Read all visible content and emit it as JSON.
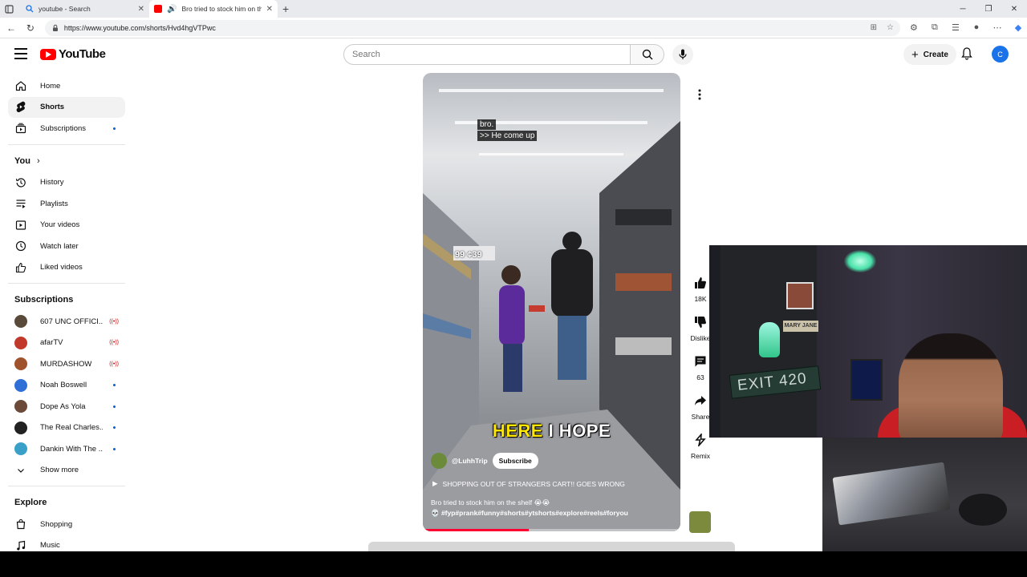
{
  "browser": {
    "tabs": [
      {
        "title": "youtube - Search",
        "active": false
      },
      {
        "title": "Bro tried to stock him on the",
        "active": true
      }
    ],
    "url": "https://www.youtube.com/shorts/Hvd4hgVTPwc"
  },
  "header": {
    "logo": "YouTube",
    "search_placeholder": "Search",
    "create_label": "Create",
    "avatar_letter": "C"
  },
  "sidebar": {
    "main": [
      {
        "label": "Home",
        "icon": "home-icon"
      },
      {
        "label": "Shorts",
        "icon": "shorts-icon",
        "active": true
      },
      {
        "label": "Subscriptions",
        "icon": "subscriptions-icon",
        "dot": true
      }
    ],
    "you_heading": "You",
    "you": [
      {
        "label": "History",
        "icon": "history-icon"
      },
      {
        "label": "Playlists",
        "icon": "playlists-icon"
      },
      {
        "label": "Your videos",
        "icon": "your-videos-icon"
      },
      {
        "label": "Watch later",
        "icon": "watch-later-icon"
      },
      {
        "label": "Liked videos",
        "icon": "liked-videos-icon"
      }
    ],
    "subs_heading": "Subscriptions",
    "subs": [
      {
        "label": "607 UNC OFFICI...",
        "color": "#5a4a3a",
        "live": true
      },
      {
        "label": "afarTV",
        "color": "#c0392b",
        "live": true
      },
      {
        "label": "MURDASHOW",
        "color": "#a0522d",
        "live": true
      },
      {
        "label": "Noah Boswell",
        "color": "#2f6fd6",
        "dot": true
      },
      {
        "label": "Dope As Yola",
        "color": "#6b4a3a",
        "dot": true
      },
      {
        "label": "The Real Charles...",
        "color": "#222222",
        "dot": true
      },
      {
        "label": "Dankin With The ...",
        "color": "#3aa0c8",
        "dot": true
      }
    ],
    "show_more": "Show more",
    "explore_heading": "Explore",
    "explore": [
      {
        "label": "Shopping",
        "icon": "shopping-icon"
      },
      {
        "label": "Music",
        "icon": "music-icon"
      }
    ]
  },
  "short": {
    "caption_line1": "bro.",
    "caption_line2": ">> He come up",
    "price_text": "99 ¢39",
    "overlay_word1": "HERE",
    "overlay_word2": "I HOPE",
    "channel": "@LuhhTrip",
    "subscribe": "Subscribe",
    "song": "SHOPPING OUT OF STRANGERS CART!! GOES WRONG",
    "desc_line1": "Bro tried to stock him on the shelf 😭😭",
    "desc_line2": "💀 #fyp#prank#funny#shorts#ytshorts#explore#reels#foryou",
    "progress": 0.41
  },
  "actions": {
    "likes": "18K",
    "dislike": "Dislike",
    "comments": "63",
    "share": "Share",
    "remix": "Remix"
  },
  "webcam": {
    "exit_sign": "EXIT 420",
    "sign_text": "MARY JANE"
  }
}
